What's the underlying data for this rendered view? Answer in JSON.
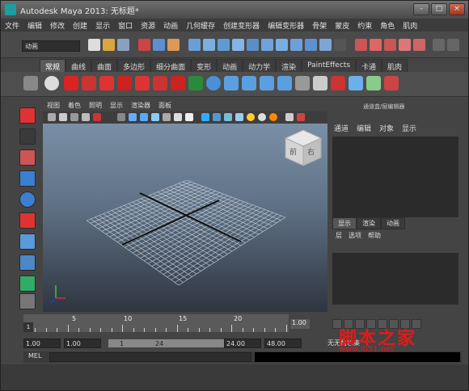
{
  "window": {
    "title": "Autodesk Maya 2013: 无标题*",
    "controls": [
      "-",
      "□",
      "×"
    ]
  },
  "menubar": {
    "items": [
      "文件",
      "编辑",
      "修改",
      "创建",
      "显示",
      "窗口",
      "资源",
      "动画",
      "几何缓存",
      "创建变形器",
      "编辑变形器",
      "骨架",
      "蒙皮",
      "约束",
      "角色",
      "肌肉"
    ]
  },
  "toolbar": {
    "mode_selector": "动画"
  },
  "shelf": {
    "tabs": [
      "常规",
      "曲线",
      "曲面",
      "多边形",
      "细分曲面",
      "变形",
      "动画",
      "动力学",
      "渲染",
      "PaintEffects",
      "卡通",
      "肌肉"
    ],
    "active_tab": "常规"
  },
  "viewport": {
    "menu": [
      "视图",
      "着色",
      "照明",
      "显示",
      "渲染器",
      "面板"
    ],
    "viewcube": {
      "front_label": "前",
      "right_label": "右"
    }
  },
  "right_panel": {
    "title": "通道盒/层编辑器",
    "menu": [
      "通道",
      "编辑",
      "对象",
      "显示"
    ],
    "tabs": [
      "显示",
      "渲染",
      "动画"
    ],
    "active_tab": "显示",
    "sub_menu": [
      "层",
      "选项",
      "帮助"
    ]
  },
  "timeline": {
    "ticks": [
      "5",
      "10",
      "15",
      "20"
    ],
    "current_frame": "1",
    "current_frame_field": "1.00"
  },
  "range": {
    "start": "1.00",
    "playback_start": "1.00",
    "range_start_label": "1",
    "range_end_label": "24",
    "playback_end": "24.00",
    "end": "48.00",
    "character_set": "无无角色集"
  },
  "mel": {
    "label": "MEL"
  },
  "watermark": {
    "line1": "脚本之家",
    "line2": "www.jb51.net"
  }
}
